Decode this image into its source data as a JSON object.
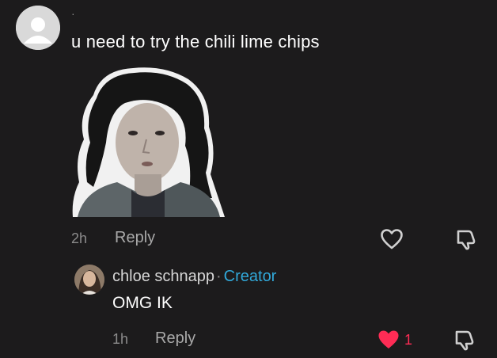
{
  "comment": {
    "username": "·",
    "text": "u need to try the chili lime chips",
    "time": "2h",
    "reply_label": "Reply"
  },
  "reply": {
    "username": "chloe schnapp",
    "separator": "·",
    "badge": "Creator",
    "text": "OMG IK",
    "time": "1h",
    "reply_label": "Reply",
    "like_count": "1",
    "liked": true
  },
  "icons": {
    "like": "heart-icon",
    "dislike": "dislike-icon"
  },
  "colors": {
    "background": "#1c1b1c",
    "creator": "#31a8d9",
    "liked": "#fe2c55"
  }
}
